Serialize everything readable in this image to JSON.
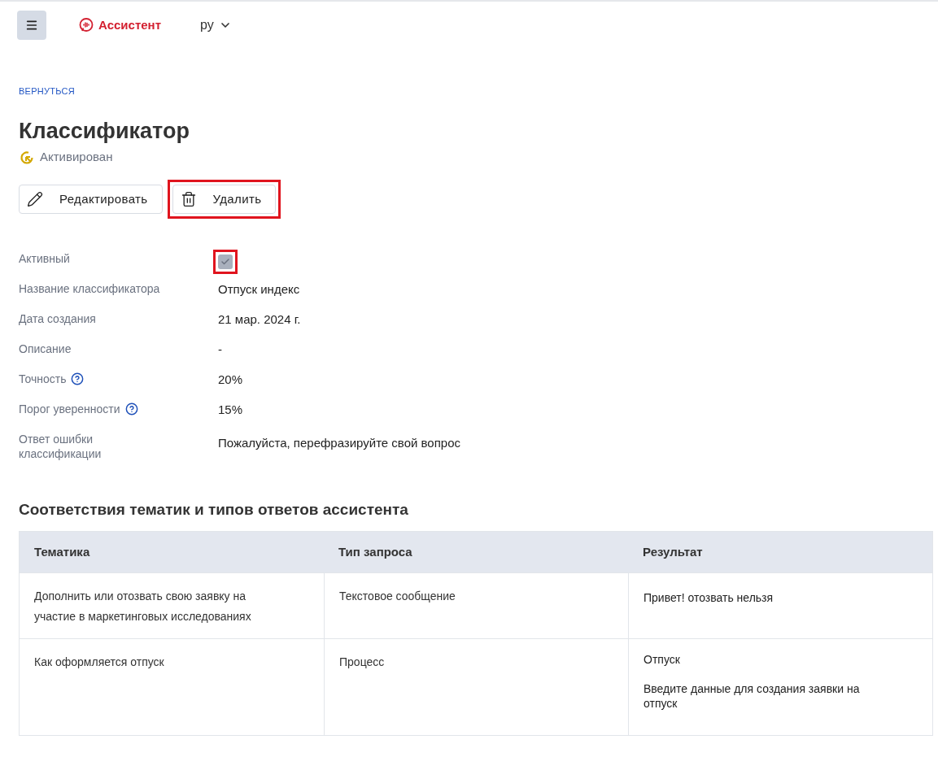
{
  "header": {
    "brand": "Ассистент",
    "language": "ру"
  },
  "back_link": "ВЕРНУТЬСЯ",
  "title": "Классификатор",
  "status": "Активирован",
  "actions": [
    {
      "kind": "edit",
      "label": "Редактировать",
      "highlighted": false
    },
    {
      "kind": "delete",
      "label": "Удалить",
      "highlighted": true
    }
  ],
  "fields": [
    {
      "kind": "checkbox",
      "label": "Активный",
      "checked": true,
      "disabled": true,
      "highlighted": true
    },
    {
      "kind": "text",
      "label": "Название классификатора",
      "value": "Отпуск индекс",
      "help": false
    },
    {
      "kind": "text",
      "label": "Дата создания",
      "value": "21 мар. 2024 г.",
      "help": false
    },
    {
      "kind": "text",
      "label": "Описание",
      "value": "-",
      "help": false
    },
    {
      "kind": "text",
      "label": "Точность",
      "value": "20%",
      "help": true
    },
    {
      "kind": "text",
      "label": "Порог уверенности",
      "value": "15%",
      "help": true
    },
    {
      "kind": "text",
      "label": "Ответ ошибки классификации",
      "value": "Пожалуйста, перефразируйте свой вопрос",
      "help": false
    }
  ],
  "mapping": {
    "title": "Соответствия тематик и типов ответов ассистента",
    "columns": [
      "Тематика",
      "Тип запроса",
      "Результат"
    ],
    "rows": [
      {
        "topic": "Дополнить или отозвать свою заявку на участие в маркетинговых исследованиях",
        "request_type": "Текстовое сообщение",
        "result": [
          "Привет! отозвать нельзя"
        ]
      },
      {
        "topic": "Как оформляется отпуск",
        "request_type": "Процесс",
        "result": [
          "Отпуск",
          "Введите данные для создания заявки на отпуск"
        ]
      }
    ]
  }
}
